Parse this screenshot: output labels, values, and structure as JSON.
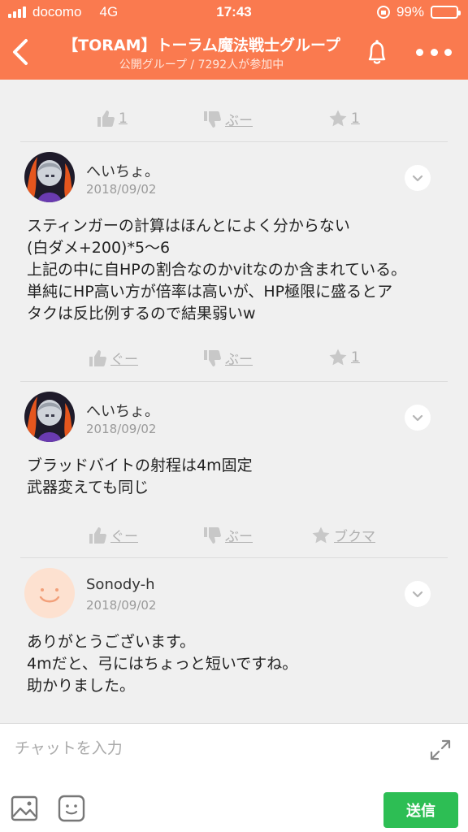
{
  "status_bar": {
    "carrier": "docomo",
    "network": "4G",
    "time": "17:43",
    "battery": "99%"
  },
  "header": {
    "title": "【TORAM】トーラム魔法戦士グループ",
    "subtitle": "公開グループ / 7292人が参加中",
    "back_icon": "chevron-left-icon",
    "bell_icon": "bell-icon",
    "more_icon": "more-dots-icon"
  },
  "reaction_rows": [
    {
      "like": "1",
      "dislike": "ぶー",
      "bookmark": "1"
    },
    {
      "like": "ぐー",
      "dislike": "ぶー",
      "bookmark": "1"
    },
    {
      "like": "ぐー",
      "dislike": "ぶー",
      "bookmark": "ブクマ"
    }
  ],
  "posts": [
    {
      "user": "へいちょ。",
      "date": "2018/09/02",
      "text": "スティンガーの計算はほんとによく分からない\n(白ダメ+200)*5〜6\n上記の中に自HPの割合なのかvitなのか含まれている。\n単純にHP高い方が倍率は高いが、HP極限に盛るとア\nタクは反比例するので結果弱いw"
    },
    {
      "user": "へいちょ。",
      "date": "2018/09/02",
      "text": "ブラッドバイトの射程は4m固定\n武器変えても同じ"
    },
    {
      "user": "Sonody-h",
      "date": "2018/09/02",
      "text": "ありがとうございます。\n4mだと、弓にはちょっと短いですね。\n助かりました。"
    }
  ],
  "input_bar": {
    "placeholder": "チャットを入力",
    "send_label": "送信"
  },
  "colors": {
    "accent": "#fa7a4f",
    "send": "#2dbe54"
  }
}
